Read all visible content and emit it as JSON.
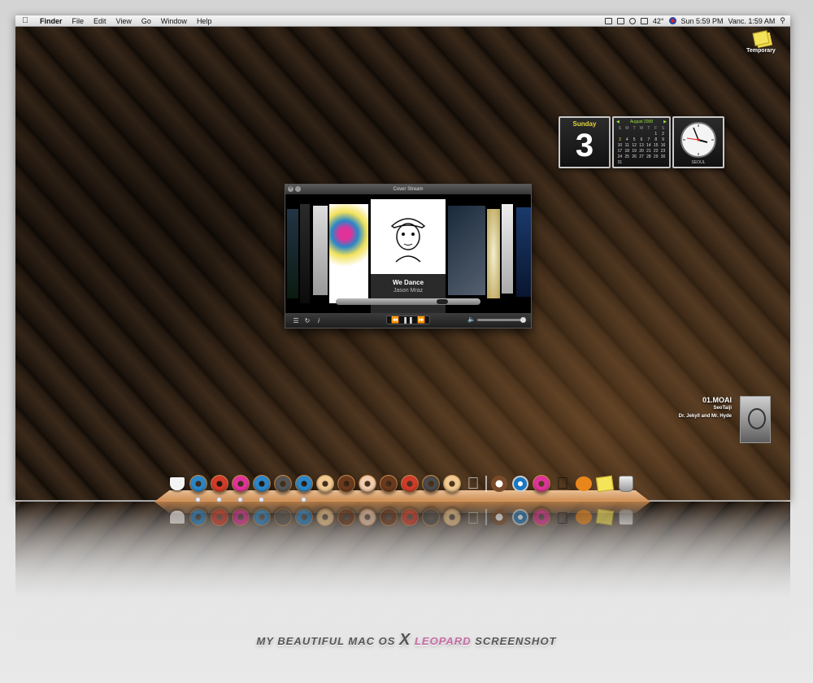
{
  "menubar": {
    "apple_label": "",
    "items": [
      "Finder",
      "File",
      "Edit",
      "View",
      "Go",
      "Window",
      "Help"
    ],
    "status": {
      "temperature": "42°",
      "datetime": "Sun 5:59 PM",
      "second_clock": "Vanc. 1:59 AM"
    }
  },
  "desktop": {
    "icon_label": "Temporary"
  },
  "widgets": {
    "day": {
      "weekday": "Sunday",
      "number": "3"
    },
    "calendar": {
      "month": "August 2008",
      "weekdays": [
        "S",
        "M",
        "T",
        "W",
        "T",
        "F",
        "S"
      ],
      "days": [
        "",
        "",
        "",
        "",
        "",
        "1",
        "2",
        "3",
        "4",
        "5",
        "6",
        "7",
        "8",
        "9",
        "10",
        "11",
        "12",
        "13",
        "14",
        "15",
        "16",
        "17",
        "18",
        "19",
        "20",
        "21",
        "22",
        "23",
        "24",
        "25",
        "26",
        "27",
        "28",
        "29",
        "30",
        "31",
        "",
        "",
        "",
        "",
        "",
        ""
      ],
      "today": "3"
    },
    "clock": {
      "city": "SEOUL"
    }
  },
  "coverstream": {
    "title": "Cover Stream",
    "song": "We Dance",
    "artist": "Jason Mraz"
  },
  "nowplaying": {
    "track": "01.MOAI",
    "artist": "SeoTaiji",
    "album": "Dr. Jekyll and Mr. Hyde"
  },
  "dock": {
    "items": [
      {
        "name": "coffee-cup-icon",
        "kind": "cup",
        "running": false
      },
      {
        "name": "blue-donut-icon",
        "kind": "donut",
        "color": "#2a86c8",
        "dough": "#c98a4a",
        "running": true
      },
      {
        "name": "red-donut-icon",
        "kind": "donut",
        "color": "#d23a2a",
        "dough": "#c98a4a",
        "running": true
      },
      {
        "name": "pink-donut-icon",
        "kind": "donut",
        "color": "#e0339a",
        "dough": "#c98a4a",
        "running": true
      },
      {
        "name": "blue-donut-icon",
        "kind": "donut",
        "color": "#2a86c8",
        "dough": "#c98a4a",
        "running": true
      },
      {
        "name": "gray-donut-icon",
        "kind": "donut",
        "color": "#555555",
        "dough": "#c98a4a",
        "running": false
      },
      {
        "name": "blue-donut-icon",
        "kind": "donut",
        "color": "#2a86c8",
        "dough": "#c98a4a",
        "running": true
      },
      {
        "name": "glazed-donut-icon",
        "kind": "donut",
        "color": "#f0c890",
        "dough": "#d8a86a",
        "running": false
      },
      {
        "name": "chocolate-donut-icon",
        "kind": "donut",
        "color": "#6a3a1e",
        "dough": "#c98a4a",
        "running": false
      },
      {
        "name": "sprinkle-donut-icon",
        "kind": "donut",
        "color": "#f1cbb0",
        "dough": "#c98a4a",
        "running": false
      },
      {
        "name": "chocolate-donut-icon",
        "kind": "donut",
        "color": "#6a3a1e",
        "dough": "#c98a4a",
        "running": false
      },
      {
        "name": "red-donut-icon",
        "kind": "donut",
        "color": "#d23a2a",
        "dough": "#c98a4a",
        "running": false
      },
      {
        "name": "gray-donut-icon",
        "kind": "donut",
        "color": "#4a4a4a",
        "dough": "#c98a4a",
        "running": false
      },
      {
        "name": "glazed-donut-icon",
        "kind": "donut",
        "color": "#f0c890",
        "dough": "#d8a86a",
        "running": false
      },
      {
        "name": "silver-apple-icon",
        "kind": "apple",
        "running": false
      },
      {
        "name": "separator",
        "kind": "separator"
      },
      {
        "name": "clock-donut-icon",
        "kind": "clock",
        "running": false
      },
      {
        "name": "network-icon",
        "kind": "network",
        "running": false
      },
      {
        "name": "pink-apple-donut-icon",
        "kind": "donut",
        "color": "#e0339a",
        "dough": "#c98a4a",
        "running": false
      },
      {
        "name": "black-apple-icon",
        "kind": "apple-dark",
        "running": false
      },
      {
        "name": "pumpkin-icon",
        "kind": "pumpkin",
        "running": false
      },
      {
        "name": "sticky-notes-icon",
        "kind": "notes",
        "running": false
      },
      {
        "name": "trash-icon",
        "kind": "trash",
        "running": false
      }
    ]
  },
  "caption": {
    "part1": "MY BEAUTIFUL MAC OS ",
    "x": "X",
    "accent": " LEOPARD",
    "part2": " SCREENSHOT"
  }
}
